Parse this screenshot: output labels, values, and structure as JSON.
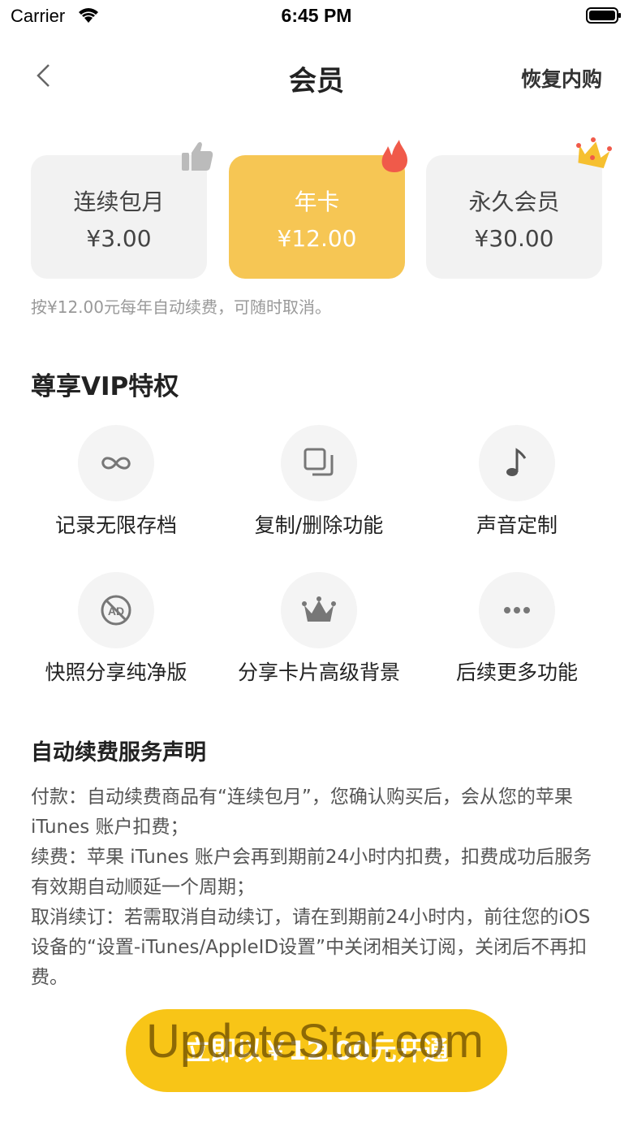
{
  "status_bar": {
    "carrier": "Carrier",
    "time": "6:45 PM"
  },
  "nav": {
    "title": "会员",
    "restore_label": "恢复内购"
  },
  "plans": [
    {
      "name": "连续包月",
      "price": "¥3.00",
      "badge": "thumbs-up-icon",
      "selected": false
    },
    {
      "name": "年卡",
      "price": "¥12.00",
      "badge": "fire-icon",
      "selected": true
    },
    {
      "name": "永久会员",
      "price": "¥30.00",
      "badge": "crown-icon",
      "selected": false
    }
  ],
  "plan_note": "按¥12.00元每年自动续费，可随时取消。",
  "privileges": {
    "title": "尊享VIP特权",
    "items": [
      {
        "label": "记录无限存档",
        "icon": "infinity-icon"
      },
      {
        "label": "复制/删除功能",
        "icon": "copy-icon"
      },
      {
        "label": "声音定制",
        "icon": "music-note-icon"
      },
      {
        "label": "快照分享纯净版",
        "icon": "no-ads-icon"
      },
      {
        "label": "分享卡片高级背景",
        "icon": "crown-icon"
      },
      {
        "label": "后续更多功能",
        "icon": "more-icon"
      }
    ]
  },
  "declaration": {
    "title": "自动续费服务声明",
    "paragraphs": [
      "付款：自动续费商品有“连续包月”，您确认购买后，会从您的苹果 iTunes 账户扣费；",
      "续费：苹果 iTunes 账户会再到期前24小时内扣费，扣费成功后服务有效期自动顺延一个周期；",
      "取消续订：若需取消自动续订，请在到期前24小时内，前往您的iOS设备的“设置-iTunes/AppleID设置”中关闭相关订阅，关闭后不再扣费。"
    ]
  },
  "cta": {
    "label": "立即以￥12.00元开通"
  },
  "watermark": "UpdateStar.com",
  "colors": {
    "accent": "#f6c654",
    "cta": "#f8c517",
    "card_bg": "#f2f2f2",
    "fire": "#f05a4a"
  }
}
